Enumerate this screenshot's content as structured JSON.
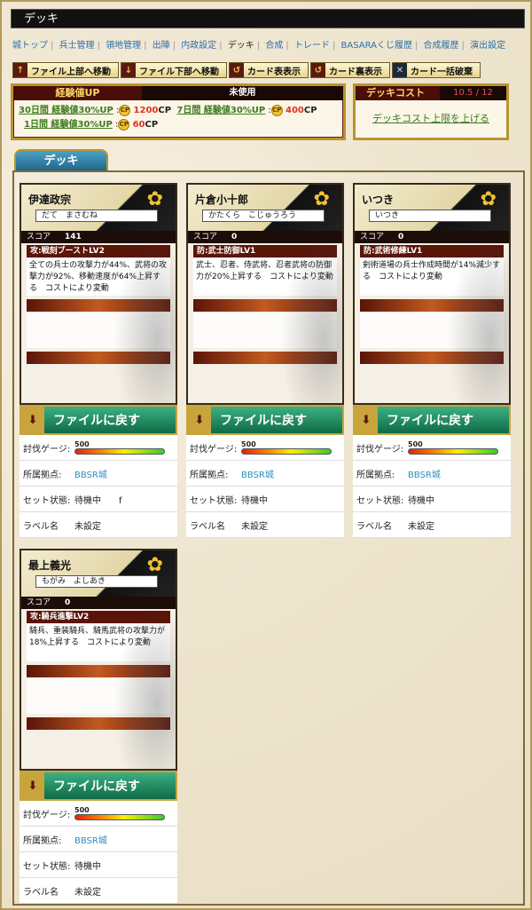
{
  "title": "デッキ",
  "nav": [
    {
      "label": "城トップ",
      "current": false
    },
    {
      "label": "兵士管理",
      "current": false
    },
    {
      "label": "領地管理",
      "current": false
    },
    {
      "label": "出陣",
      "current": false
    },
    {
      "label": "内政設定",
      "current": false
    },
    {
      "label": "デッキ",
      "current": true
    },
    {
      "label": "合成",
      "current": false
    },
    {
      "label": "トレード",
      "current": false
    },
    {
      "label": "BASARAくじ履歴",
      "current": false
    },
    {
      "label": "合成履歴",
      "current": false
    },
    {
      "label": "演出設定",
      "current": false
    }
  ],
  "tools": [
    {
      "label": "ファイル上部へ移動",
      "icon": "↑"
    },
    {
      "label": "ファイル下部へ移動",
      "icon": "↓"
    },
    {
      "label": "カード表表示",
      "icon": "↺"
    },
    {
      "label": "カード裏表示",
      "icon": "↺"
    },
    {
      "label": "カード一括破棄",
      "icon": "✕"
    }
  ],
  "exp": {
    "head": "経験値UP",
    "status": "未使用",
    "opt1": "30日間 経験値30%UP",
    "opt1_cp": "1200",
    "opt2": "7日間 経験値30%UP",
    "opt2_cp": "400",
    "opt3": "1日間 経験値30%UP",
    "opt3_cp": "60",
    "cp_unit": "CP",
    "cp_icon": "CP"
  },
  "cost": {
    "head": "デッキコスト",
    "value": "10.5 / 12",
    "link": "デッキコスト上限を上げる"
  },
  "deck_tab": "デッキ",
  "labels": {
    "score": "スコア",
    "return": "ファイルに戻す",
    "gauge": "討伐ゲージ:",
    "base": "所属拠点:",
    "state": "セット状態:",
    "label": "ラベル名"
  },
  "cards": [
    {
      "name": "伊達政宗",
      "kana": "だて　まさむね",
      "score": "141",
      "skill": "攻:戦刻ブーストLV2",
      "desc": "全ての兵士の攻撃力が44%、武将の攻撃力が92%、移動速度が64%上昇する　コストにより変動",
      "gauge": "500",
      "base": "BBSR城",
      "state": "待機中",
      "state_extra": "f",
      "label": "未設定"
    },
    {
      "name": "片倉小十郎",
      "kana": "かたくら　こじゅうろう",
      "score": "0",
      "skill": "防:武士防御LV1",
      "desc": "武士、忍者、侍武将、忍者武将の防御力が20%上昇する　コストにより変動",
      "gauge": "500",
      "base": "BBSR城",
      "state": "待機中",
      "state_extra": "",
      "label": "未設定"
    },
    {
      "name": "いつき",
      "kana": "いつき",
      "score": "0",
      "skill": "防:武術修練LV1",
      "desc": "剣術道場の兵士作成時間が14%減少する　コストにより変動",
      "gauge": "500",
      "base": "BBSR城",
      "state": "待機中",
      "state_extra": "",
      "label": "未設定"
    },
    {
      "name": "最上義光",
      "kana": "もがみ　よしあき",
      "score": "0",
      "skill": "攻:騎兵進撃LV2",
      "desc": "騎兵、重装騎兵、騎馬武将の攻撃力が18%上昇する　コストにより変動",
      "gauge": "500",
      "base": "BBSR城",
      "state": "待機中",
      "state_extra": "",
      "label": "未設定"
    }
  ]
}
